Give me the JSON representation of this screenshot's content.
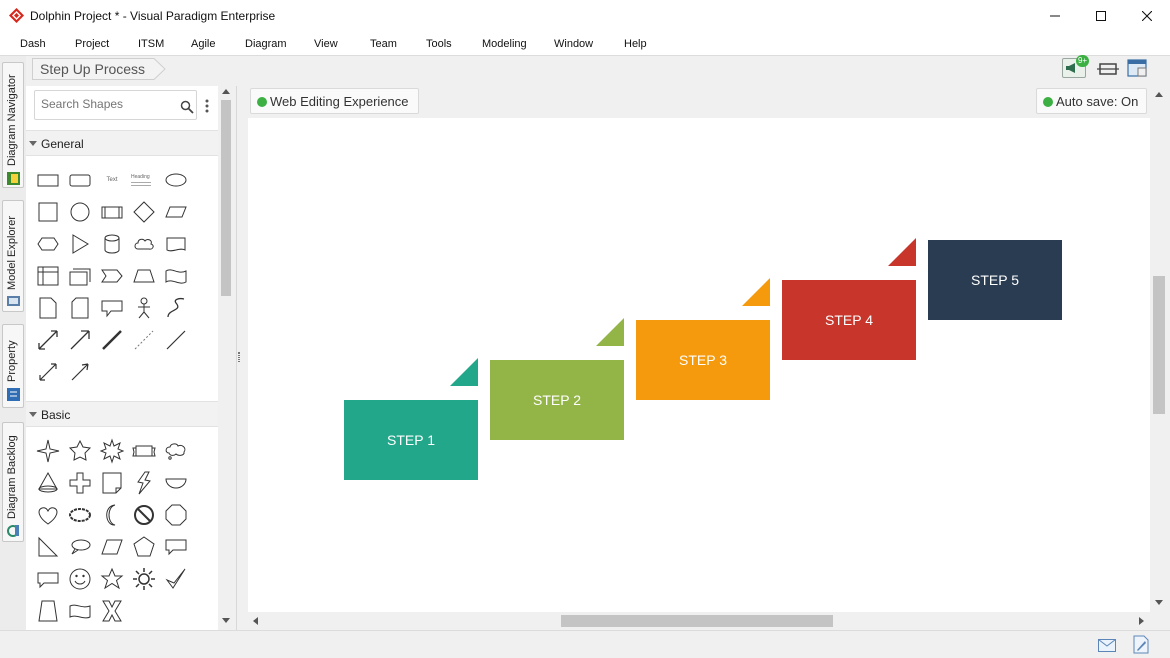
{
  "window": {
    "title": "Dolphin Project * - Visual Paradigm Enterprise",
    "minimize_glyph": "—",
    "maximize_glyph": "☐",
    "close_glyph": "✕"
  },
  "menu": [
    "Dash",
    "Project",
    "ITSM",
    "Agile",
    "Diagram",
    "View",
    "Team",
    "Tools",
    "Modeling",
    "Window",
    "Help"
  ],
  "left_tabs": [
    "Diagram Navigator",
    "Model Explorer",
    "Property",
    "Diagram Backlog"
  ],
  "breadcrumb": "Step Up Process",
  "toolbar": {
    "notification_badge": "9+"
  },
  "palette": {
    "search_placeholder": "Search Shapes",
    "sections": [
      {
        "label": "General",
        "shape_text": "Text",
        "shape_heading": "Heading"
      },
      {
        "label": "Basic"
      }
    ]
  },
  "canvas": {
    "web_editing_label": "Web Editing Experience",
    "autosave_label": "Auto save: On",
    "steps": [
      {
        "label": "STEP 1",
        "color": "#22a78a"
      },
      {
        "label": "STEP 2",
        "color": "#93b548"
      },
      {
        "label": "STEP 3",
        "color": "#f59a0c"
      },
      {
        "label": "STEP 4",
        "color": "#c8352a"
      },
      {
        "label": "STEP 5",
        "color": "#2a3c52"
      }
    ]
  },
  "colors": {
    "accent_green": "#3cb043",
    "brand_red": "#d9261c"
  },
  "icons": {
    "window_icon": "app-logo-icon",
    "status_right": [
      "mail-icon",
      "note-icon"
    ]
  }
}
